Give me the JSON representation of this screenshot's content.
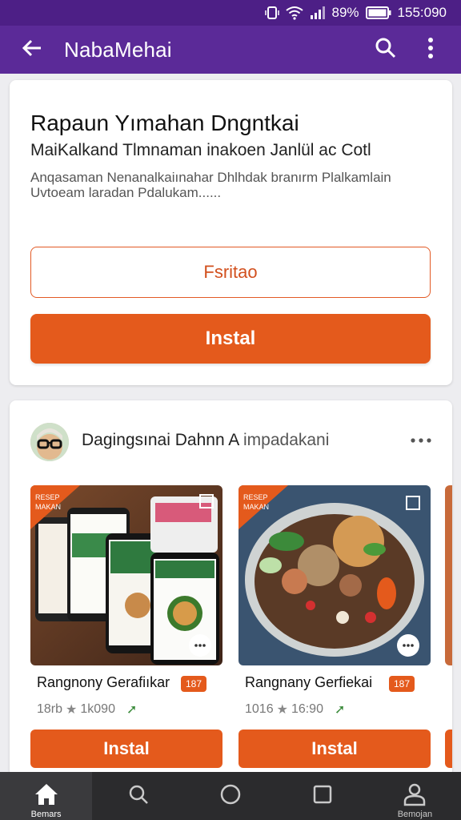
{
  "status_bar": {
    "battery_percent": "89%",
    "time": "155:090",
    "icons": [
      "vibrate-icon",
      "wifi-icon",
      "signal-icon",
      "battery-icon"
    ]
  },
  "app_bar": {
    "title": "NabaMehai",
    "icons": [
      "back-arrow-icon",
      "search-icon",
      "more-vert-icon"
    ]
  },
  "promo_card": {
    "heading": "Rapaun Yımahan Dngntkai",
    "subheading": "MaiKalkand Tlmnaman inakoen Janlül ac Cotl",
    "description_line1": "Anqasaman Nenanalkaiınahar Dhlhdak branırm Plalkamlain",
    "description_line2": "Uvtoeam laradan Pdalukam......",
    "outline_button": "Fsritao",
    "primary_button": "Instal"
  },
  "post_card": {
    "author": "Dagingsınai Dahnn A",
    "action": "impadakani",
    "apps": [
      {
        "name": "Rangnony Gerafiıkar",
        "badge": "187",
        "rating_text": "18rb",
        "downloads": "1k090",
        "install_label": "Instal"
      },
      {
        "name": "Rangnany Gerfiekai",
        "badge": "187",
        "rating_text": "1016",
        "downloads": "16:90",
        "install_label": "Instal"
      }
    ]
  },
  "bottom_nav": {
    "items": [
      {
        "label": "Bemars",
        "icon": "home-icon",
        "active": true
      },
      {
        "label": "",
        "icon": "search-icon",
        "active": false
      },
      {
        "label": "",
        "icon": "circle-icon",
        "active": false
      },
      {
        "label": "",
        "icon": "square-icon",
        "active": false
      },
      {
        "label": "Bemojan",
        "icon": "profile-icon",
        "active": false
      }
    ]
  },
  "colors": {
    "app_bar": "#5b2a98",
    "status_bar": "#4d1f86",
    "accent": "#e45a1c",
    "bottom_nav": "#2b2b2d"
  }
}
